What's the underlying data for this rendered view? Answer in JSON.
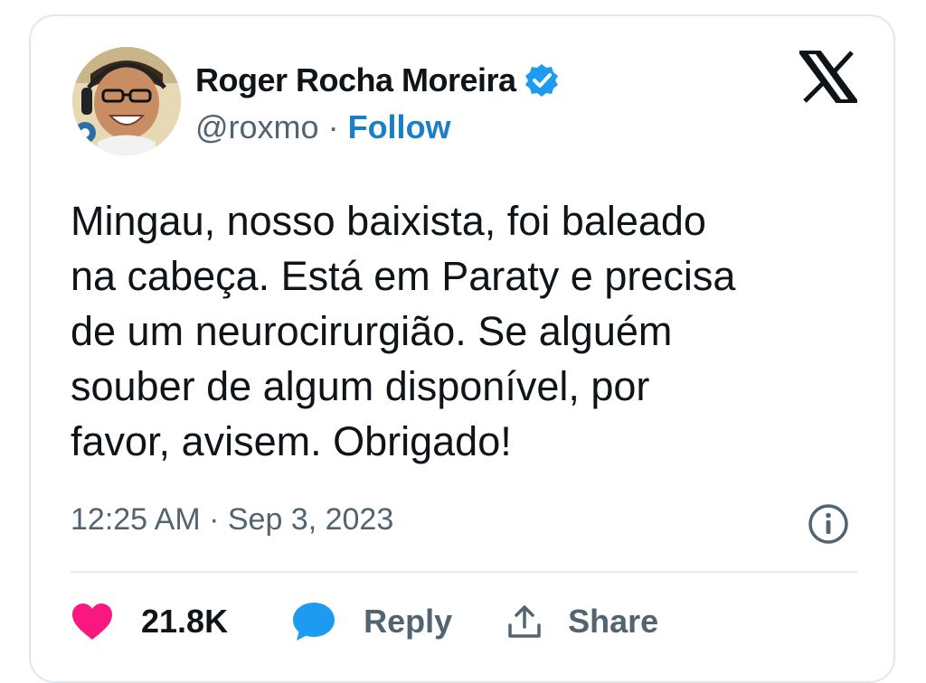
{
  "author": {
    "name": "Roger Rocha Moreira",
    "handle": "@roxmo",
    "separator": "·",
    "follow_label": "Follow",
    "verified": true
  },
  "tweet": {
    "text": "Mingau, nosso baixista, foi baleado\nna cabeça. Está em Paraty e precisa\nde um neurocirurgião. Se alguém\nsouber de algum disponível, por\nfavor, avisem. Obrigado!",
    "timestamp": "12:25 AM · Sep 3, 2023"
  },
  "actions": {
    "likes_count": "21.8K",
    "reply_label": "Reply",
    "share_label": "Share"
  },
  "icons": {
    "platform_logo": "x-logo-icon",
    "verified_badge": "verified-badge-icon",
    "info": "info-icon",
    "like": "heart-icon",
    "reply": "speech-bubble-icon",
    "share": "share-upload-icon"
  },
  "colors": {
    "accent_blue": "#1d7ec8",
    "verified_blue": "#1d9bf0",
    "heart_pink": "#f91880",
    "reply_blue": "#1d9bf0",
    "text_primary": "#0f1419",
    "text_secondary": "#536471",
    "border": "#e1e8ed"
  }
}
